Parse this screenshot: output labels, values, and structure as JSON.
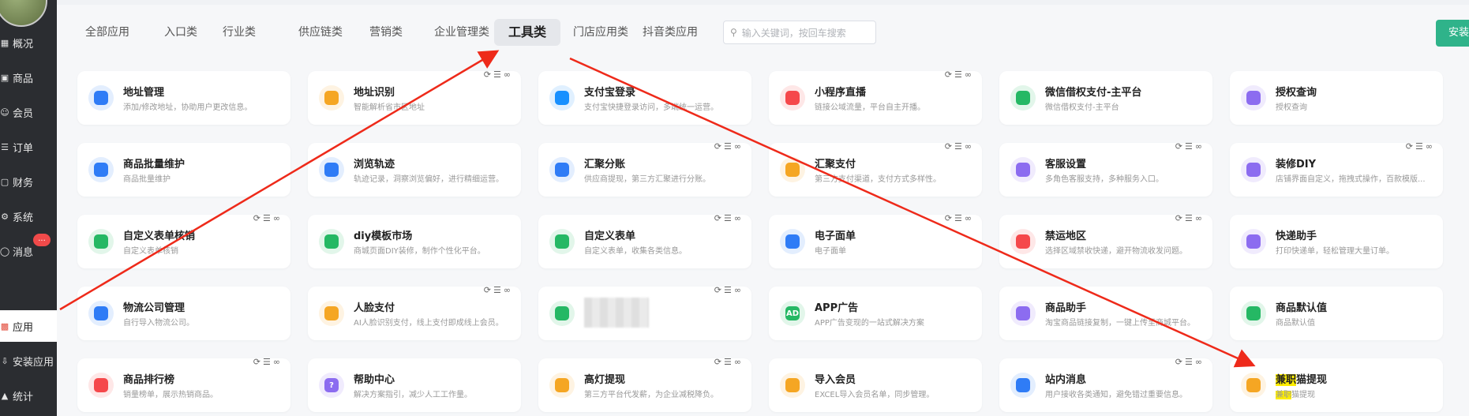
{
  "sidebar": {
    "items": [
      {
        "label": "概况",
        "icon": "chart-icon"
      },
      {
        "label": "商品",
        "icon": "goods-icon"
      },
      {
        "label": "会员",
        "icon": "user-icon"
      },
      {
        "label": "订单",
        "icon": "cart-icon"
      },
      {
        "label": "财务",
        "icon": "wallet-icon"
      },
      {
        "label": "系统",
        "icon": "gear-icon"
      },
      {
        "label": "消息",
        "icon": "message-icon"
      },
      {
        "label": "应用",
        "icon": "apps-icon",
        "active": true
      },
      {
        "label": "安装应用",
        "icon": "install-icon"
      },
      {
        "label": "统计",
        "icon": "stats-icon"
      }
    ],
    "badge": "..."
  },
  "tabs": [
    "全部应用",
    "入口类",
    "行业类",
    "供应链类",
    "营销类",
    "企业管理类",
    "工具类",
    "门店应用类",
    "抖音类应用"
  ],
  "active_tab": "工具类",
  "search": {
    "placeholder": "输入关键词，按回车搜索"
  },
  "install_button": "安装应用",
  "cards": [
    [
      {
        "title": "地址管理",
        "desc": "添加/修改地址，协助用户更改信息。",
        "color": "#2f7cf6"
      },
      {
        "title": "地址识别",
        "desc": "智能解析省市区地址",
        "color": "#f5a623",
        "acts": true
      },
      {
        "title": "支付宝登录",
        "desc": "支付宝快捷登录访问，多端统一运营。",
        "color": "#1890ff"
      },
      {
        "title": "小程序直播",
        "desc": "链接公域流量，平台自主开播。",
        "color": "#f5484b",
        "acts": true
      },
      {
        "title": "微信借权支付-主平台",
        "desc": "微信借权支付-主平台",
        "color": "#25b864"
      },
      {
        "title": "授权查询",
        "desc": "授权查询",
        "color": "#8c6cf0"
      }
    ],
    [
      {
        "title": "商品批量维护",
        "desc": "商品批量维护",
        "color": "#2f7cf6"
      },
      {
        "title": "浏览轨迹",
        "desc": "轨迹记录，洞察浏览偏好，进行精细运营。",
        "color": "#2f7cf6"
      },
      {
        "title": "汇聚分账",
        "desc": "供应商提现，第三方汇聚进行分账。",
        "color": "#2f7cf6",
        "acts": true
      },
      {
        "title": "汇聚支付",
        "desc": "第三方支付渠道，支付方式多样性。",
        "color": "#f5a623",
        "acts": true
      },
      {
        "title": "客服设置",
        "desc": "多角色客服支持，多种服务入口。",
        "color": "#8c6cf0",
        "acts": true
      },
      {
        "title": "装修DIY",
        "desc": "店铺界面自定义，拖拽式操作，百款模版...",
        "color": "#8c6cf0",
        "acts": true
      }
    ],
    [
      {
        "title": "自定义表单核销",
        "desc": "自定义表单核销",
        "color": "#25b864",
        "acts": true
      },
      {
        "title": "diy模板市场",
        "desc": "商城页面DIY装修，制作个性化平台。",
        "color": "#25b864"
      },
      {
        "title": "自定义表单",
        "desc": "自定义表单，收集各类信息。",
        "color": "#25b864",
        "acts": true
      },
      {
        "title": "电子面单",
        "desc": "电子面单",
        "color": "#2f7cf6",
        "acts": true
      },
      {
        "title": "禁运地区",
        "desc": "选择区域禁收快递，避开物流收发问题。",
        "color": "#f5484b",
        "acts": true
      },
      {
        "title": "快递助手",
        "desc": "打印快递单，轻松管理大量订单。",
        "color": "#8c6cf0"
      }
    ],
    [
      {
        "title": "物流公司管理",
        "desc": "自行导入物流公司。",
        "color": "#2f7cf6"
      },
      {
        "title": "人脸支付",
        "desc": "AI人脸识别支付，线上支付即成线上会员。",
        "color": "#f5a623",
        "acts": true
      },
      {
        "title": "",
        "desc": "",
        "color": "#25b864",
        "blur": true,
        "acts": true
      },
      {
        "title": "APP广告",
        "desc": "APP广告变现的一站式解决方案",
        "color": "#25b864",
        "label": "AD"
      },
      {
        "title": "商品助手",
        "desc": "淘宝商品链接复制，一键上传至商城平台。",
        "color": "#8c6cf0"
      },
      {
        "title": "商品默认值",
        "desc": "商品默认值",
        "color": "#25b864"
      }
    ],
    [
      {
        "title": "商品排行榜",
        "desc": "销量榜单，展示热销商品。",
        "color": "#f5484b",
        "acts": true
      },
      {
        "title": "帮助中心",
        "desc": "解决方案指引，减少人工工作量。",
        "color": "#8c6cf0",
        "label": "?"
      },
      {
        "title": "高灯提现",
        "desc": "第三方平台代发薪，为企业减税降负。",
        "color": "#f5a623",
        "acts": true
      },
      {
        "title": "导入会员",
        "desc": "EXCEL导入会员名单，同步管理。",
        "color": "#f5a623"
      },
      {
        "title": "站内消息",
        "desc": "用户接收各类通知，避免错过重要信息。",
        "color": "#2f7cf6",
        "acts": true
      },
      {
        "title": "兼职猫提现",
        "desc": "兼职猫提现",
        "color": "#f5a623",
        "highlight": "兼职"
      }
    ]
  ]
}
